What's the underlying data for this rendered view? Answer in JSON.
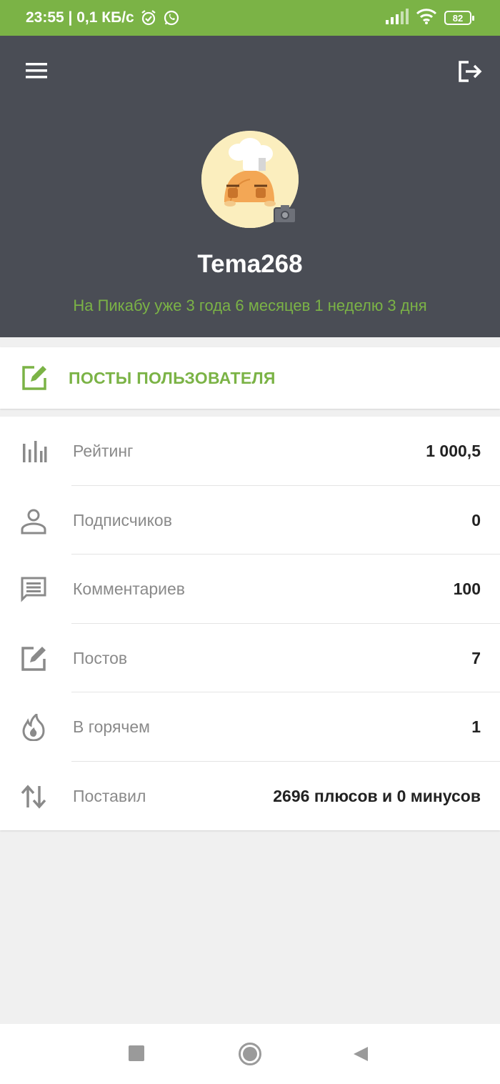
{
  "status_bar": {
    "time_speed": "23:55 | 0,1 КБ/с",
    "battery": "82",
    "icons": [
      "alarm-icon",
      "whatsapp-icon",
      "signal-icon",
      "wifi-icon",
      "battery-icon"
    ]
  },
  "header": {
    "username": "Tema268",
    "tenure": "На Пикабу уже 3 года 6 месяцев 1 неделю 3 дня",
    "icons": [
      "menu-icon",
      "logout-icon",
      "camera-icon"
    ]
  },
  "posts": {
    "label": "ПОСТЫ ПОЛЬЗОВАТЕЛЯ",
    "icon": "edit-icon"
  },
  "stats": [
    {
      "label": "Рейтинг",
      "value": "1 000,5",
      "icon": "bar-chart-icon"
    },
    {
      "label": "Подписчиков",
      "value": "0",
      "icon": "person-icon"
    },
    {
      "label": "Комментариев",
      "value": "100",
      "icon": "comment-icon"
    },
    {
      "label": "Постов",
      "value": "7",
      "icon": "edit-icon"
    },
    {
      "label": "В горячем",
      "value": "1",
      "icon": "fire-icon"
    },
    {
      "label": "Поставил",
      "value": "2696 плюсов и 0 минусов",
      "icon": "swap-vertical-icon"
    }
  ],
  "colors": {
    "accent": "#7bb346",
    "header_bg": "#4a4d55",
    "page_bg": "#f0f0f0"
  }
}
